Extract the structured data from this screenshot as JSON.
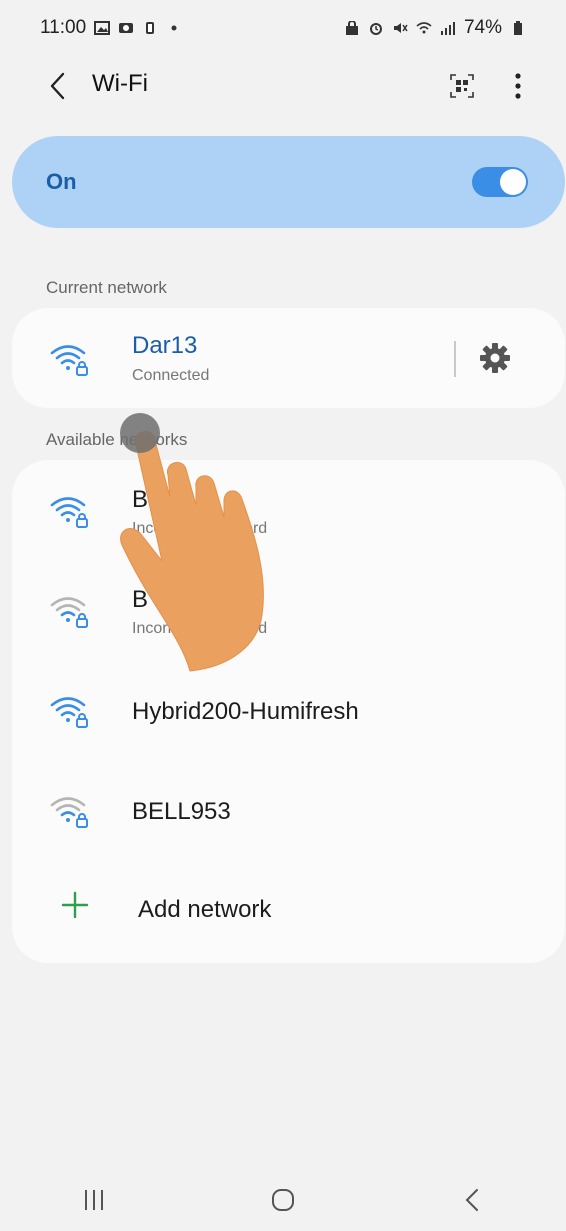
{
  "status_bar": {
    "time": "11:00",
    "battery": "74%"
  },
  "header": {
    "title": "Wi-Fi",
    "icons": [
      "back-chevron-icon",
      "qr-code-icon",
      "more-vert-icon"
    ]
  },
  "wifi_toggle": {
    "label": "On",
    "enabled": true,
    "accent_color": "#3a8ee6"
  },
  "current_network": {
    "section_label": "Current network",
    "name": "Dar13",
    "status": "Connected",
    "name_color": "#1a5ea8"
  },
  "available_networks": {
    "section_label": "Available networks",
    "items": [
      {
        "name": "B",
        "status": "Incorrect password",
        "signal": "strong"
      },
      {
        "name": "B",
        "status": "Incorrect password",
        "signal": "weak"
      },
      {
        "name": "Hybrid200-Humifresh",
        "status": "",
        "signal": "strong"
      },
      {
        "name": "BELL953",
        "status": "",
        "signal": "weak"
      }
    ],
    "add_label": "Add network"
  },
  "nav_bar": {
    "buttons": [
      "recents-icon",
      "home-icon",
      "back-icon"
    ]
  }
}
